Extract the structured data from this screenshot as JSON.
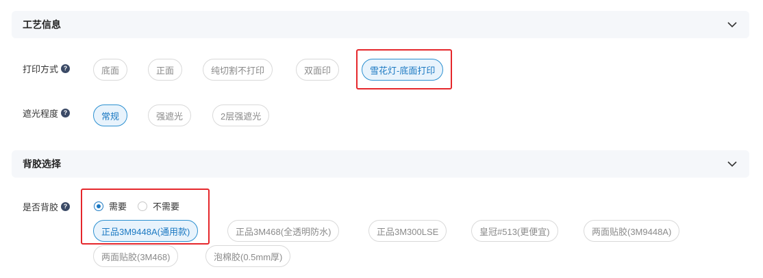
{
  "craft": {
    "title": "工艺信息",
    "print_mode": {
      "label": "打印方式",
      "options": [
        "底面",
        "正面",
        "纯切割不打印",
        "双面印",
        "雪花灯-底面打印"
      ]
    },
    "shading": {
      "label": "遮光程度",
      "options": [
        "常规",
        "强遮光",
        "2层强遮光"
      ]
    }
  },
  "adhesive": {
    "title": "背胶选择",
    "label": "是否背胶",
    "radio_options": [
      "需要",
      "不需要"
    ],
    "options": [
      "正品3M9448A(通用款)",
      "正品3M468(全透明防水)",
      "正品3M300LSE",
      "皇冠#513(更便宜)",
      "两面贴胶(3M9448A)",
      "两面贴胶(3M468)",
      "泡棉胶(0.5mm厚)"
    ]
  },
  "colors": {
    "accent": "#1a78c2",
    "highlight": "#e5262a"
  }
}
